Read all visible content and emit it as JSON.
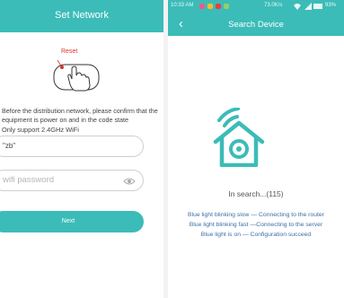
{
  "left": {
    "title": "Set Network",
    "reset_label": "Reset",
    "instructions": "Before the distribution network, please confirm that the equipment is power on and in the code state",
    "only_support": "Only support 2.4GHz WiFi",
    "ssid_value": "\"zb\"",
    "password_placeholder": "wifi password",
    "next_label": "Next"
  },
  "right": {
    "status": {
      "time": "10:33 AM",
      "speed": "73.0K/s",
      "battery": "93%"
    },
    "title": "Search Device",
    "back_icon": "chevron-left-icon",
    "searching_text": "In search...(115)",
    "legend": [
      "Blue light blinking slow — Connecting to the router",
      "Blue light blinking fast —Connecting to the server",
      "Blue light is on — Configuration succeed"
    ]
  },
  "colors": {
    "accent": "#3bbcb8",
    "legend_text": "#3a6ea8",
    "reset_red": "#e03030"
  }
}
